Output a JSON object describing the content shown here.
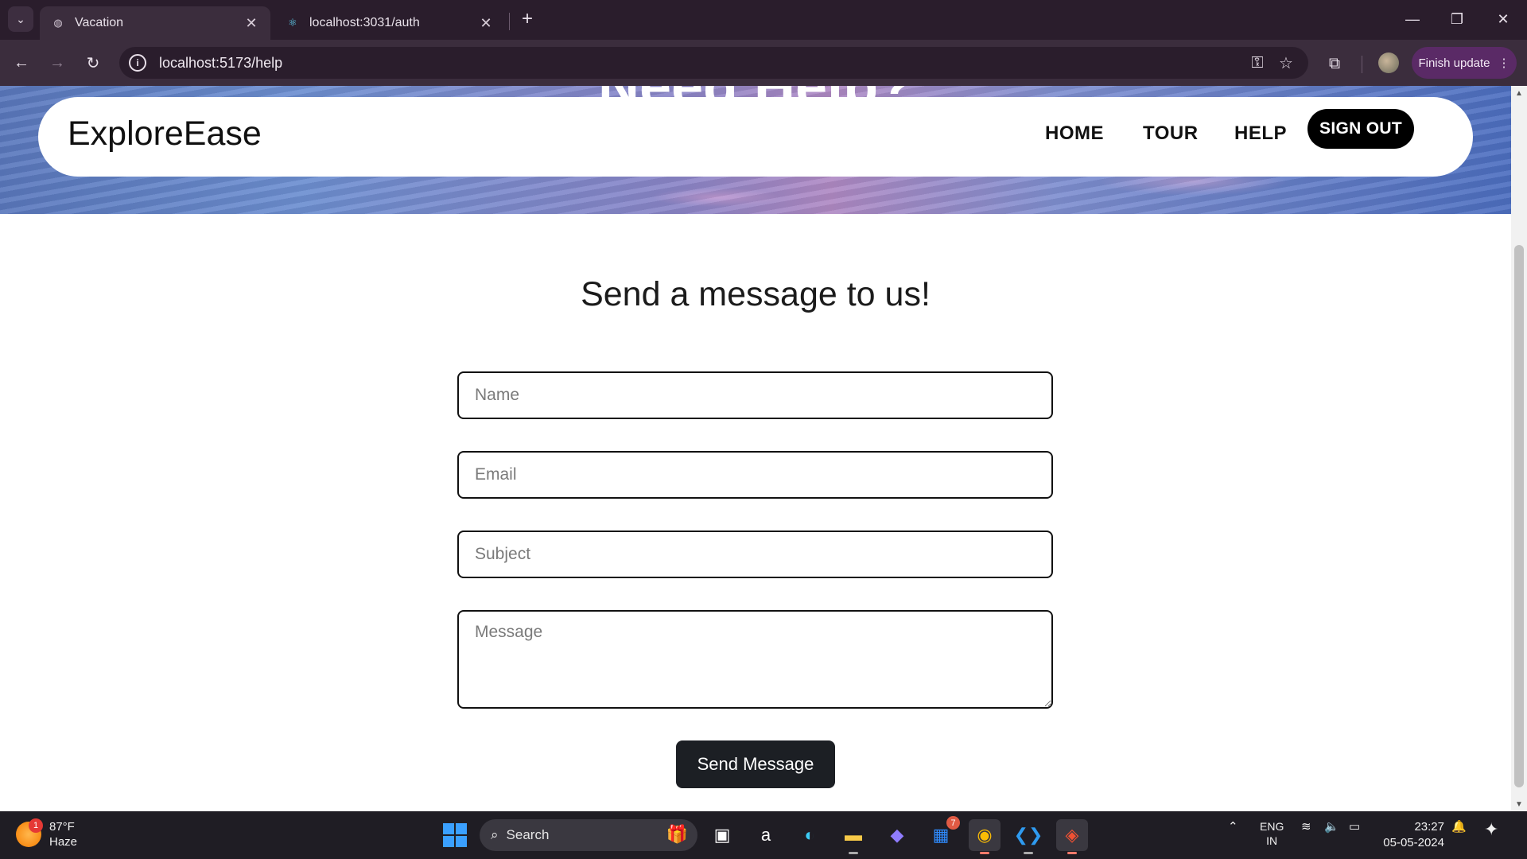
{
  "browser": {
    "tabs": [
      {
        "title": "Vacation",
        "active": true
      },
      {
        "title": "localhost:3031/auth",
        "active": false
      }
    ],
    "url": "localhost:5173/help",
    "finish_update_label": "Finish update"
  },
  "hero": {
    "title": "Need Help?"
  },
  "navbar": {
    "logo": "ExploreEase",
    "links": [
      "HOME",
      "TOUR",
      "HELP"
    ],
    "signout_label": "SIGN OUT"
  },
  "contact_form": {
    "title": "Send a message to us!",
    "name_placeholder": "Name",
    "email_placeholder": "Email",
    "subject_placeholder": "Subject",
    "message_placeholder": "Message",
    "submit_label": "Send Message"
  },
  "taskbar": {
    "weather_temp": "87°F",
    "weather_desc": "Haze",
    "weather_badge": "1",
    "search_label": "Search",
    "store_badge": "7",
    "lang_primary": "ENG",
    "lang_secondary": "IN",
    "time": "23:27",
    "date": "05-05-2024"
  }
}
